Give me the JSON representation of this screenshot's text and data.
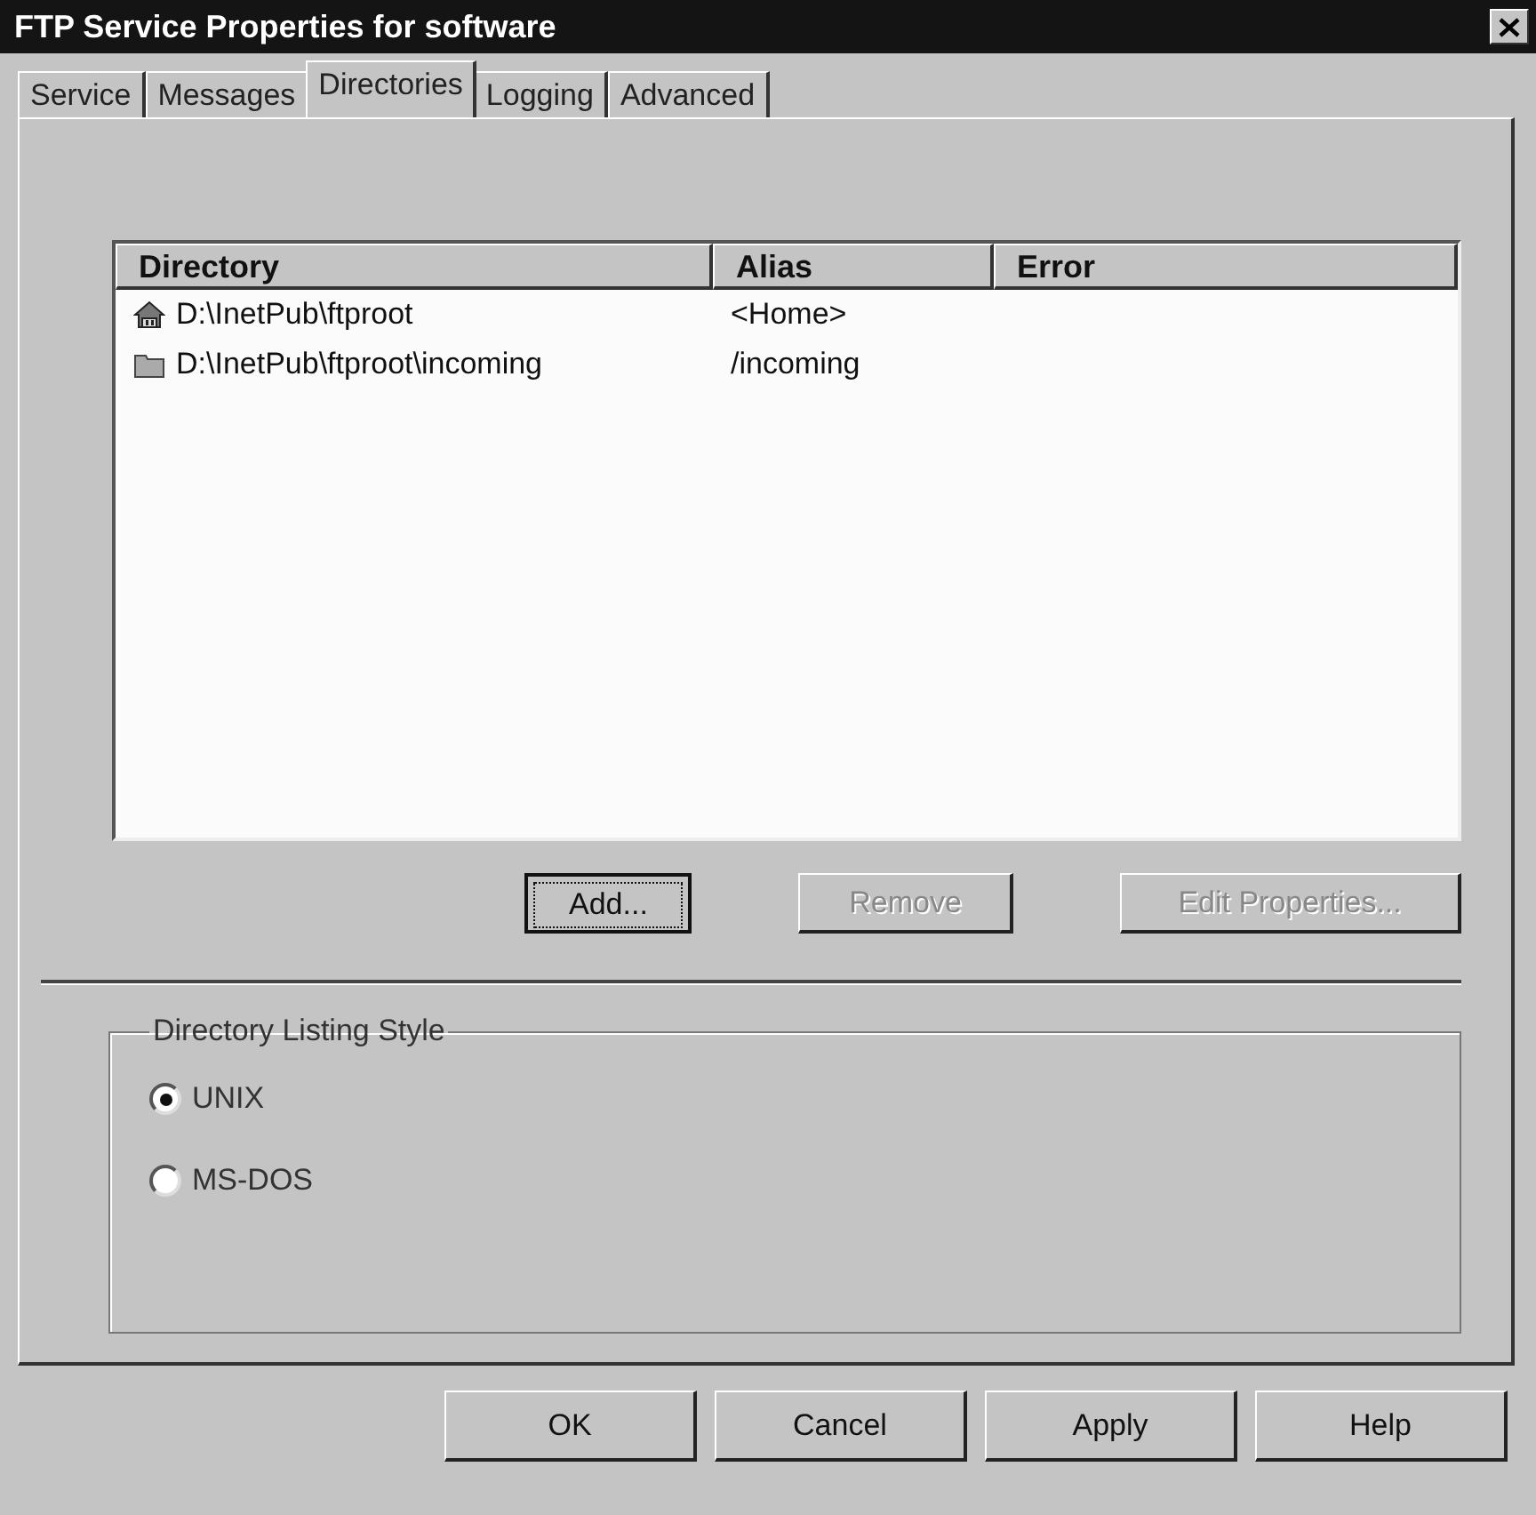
{
  "window": {
    "title": "FTP Service Properties for software"
  },
  "tabs": [
    {
      "label": "Service",
      "selected": false
    },
    {
      "label": "Messages",
      "selected": false
    },
    {
      "label": "Directories",
      "selected": true
    },
    {
      "label": "Logging",
      "selected": false
    },
    {
      "label": "Advanced",
      "selected": false
    }
  ],
  "table": {
    "columns": [
      "Directory",
      "Alias",
      "Error"
    ],
    "rows": [
      {
        "kind": "home",
        "directory": "D:\\InetPub\\ftproot",
        "alias": "<Home>"
      },
      {
        "kind": "folder",
        "directory": "D:\\InetPub\\ftproot\\incoming",
        "alias": "/incoming"
      }
    ]
  },
  "list_buttons": [
    {
      "label": "Add...",
      "disabled": false,
      "focused": true
    },
    {
      "label": "Remove",
      "disabled": true,
      "focused": false
    },
    {
      "label": "Edit Properties...",
      "disabled": true,
      "focused": false
    }
  ],
  "listing_style": {
    "label": "Directory Listing Style",
    "options": [
      {
        "label": "UNIX",
        "selected": true
      },
      {
        "label": "MS-DOS",
        "selected": false
      }
    ]
  },
  "buttons": [
    "OK",
    "Cancel",
    "Apply",
    "Help"
  ]
}
